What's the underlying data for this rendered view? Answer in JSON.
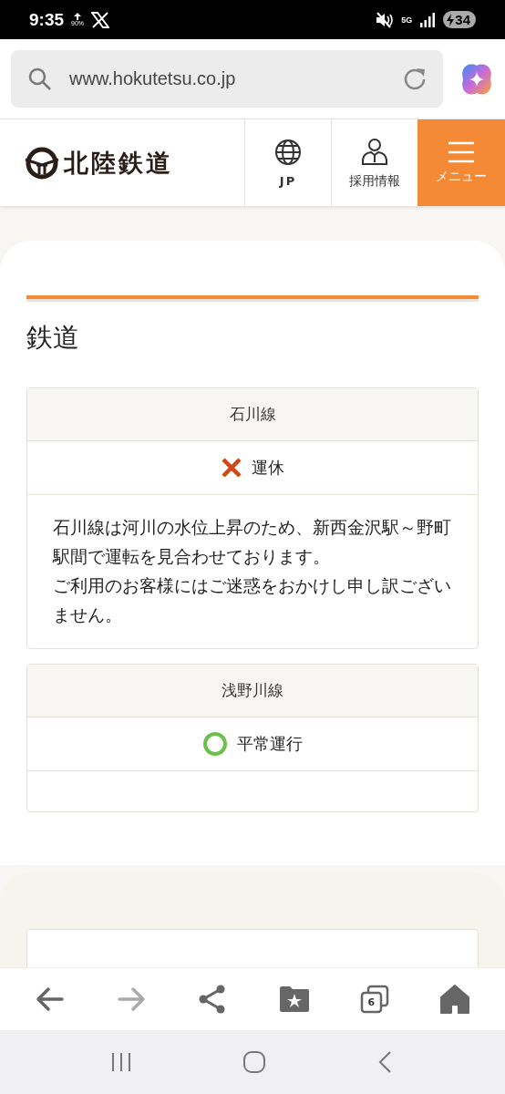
{
  "status_bar": {
    "time": "9:35",
    "upload_percent": "90%",
    "network": "5G",
    "battery": "34"
  },
  "browser": {
    "url": "www.hokutetsu.co.jp",
    "tab_count": "6"
  },
  "site_header": {
    "logo": "北陸鉄道",
    "language": "JP",
    "recruit": "採用情報",
    "menu": "メニュー"
  },
  "section": {
    "title": "鉄道",
    "lines": [
      {
        "name": "石川線",
        "kind": "suspended",
        "status": "運休",
        "message": [
          "石川線は河川の水位上昇のため、新西金沢駅～野町駅間で運転を見合わせております。",
          "ご利用のお客様にはご迷惑をおかけし申し訳ございません。"
        ]
      },
      {
        "name": "浅野川線",
        "kind": "normal",
        "status": "平常運行"
      }
    ]
  }
}
